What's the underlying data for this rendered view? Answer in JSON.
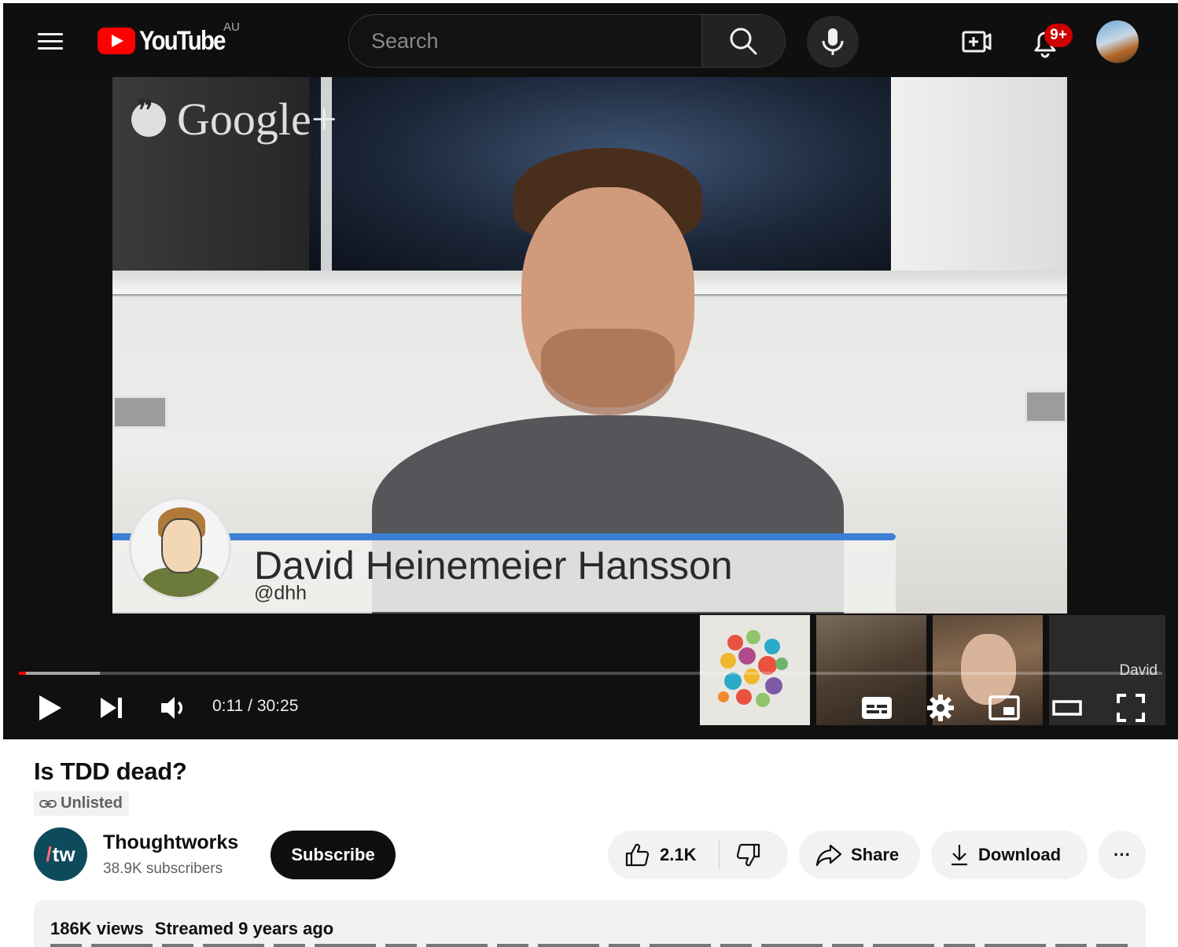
{
  "header": {
    "logo_text": "YouTube",
    "region": "AU",
    "search_placeholder": "Search",
    "notifications_badge": "9+"
  },
  "player": {
    "watermark": "Google+",
    "lower_third_name": "David Heinemeier Hansson",
    "lower_third_handle": "@dhh",
    "participant_label": "David",
    "current_time": "0:11",
    "duration": "30:25",
    "time_display": "0:11 / 30:25",
    "played_fraction": 0.006,
    "loaded_fraction": 0.071
  },
  "video": {
    "title": "Is TDD dead?",
    "visibility": "Unlisted"
  },
  "channel": {
    "logo_text": "tw",
    "name": "Thoughtworks",
    "subscribers": "38.9K subscribers",
    "subscribe_label": "Subscribe"
  },
  "actions": {
    "likes": "2.1K",
    "share_label": "Share",
    "download_label": "Download",
    "more_label": "···"
  },
  "description": {
    "views": "186K views",
    "streamed": "Streamed 9 years ago"
  },
  "colors": {
    "brand_red": "#ff0000",
    "header_bg": "#0f0f0f",
    "lower_third_blue": "#3b7fd4",
    "channel_logo_bg": "#0d4b5c"
  }
}
